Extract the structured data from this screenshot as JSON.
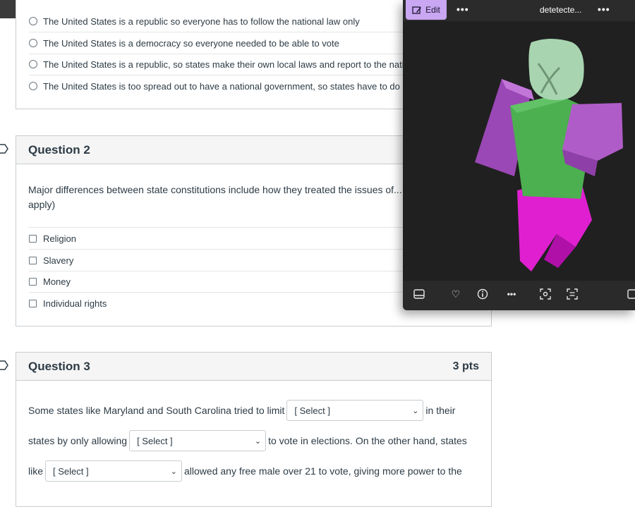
{
  "question1": {
    "answers": [
      "The United States is a republic so everyone has to follow the national law only",
      "The United States is a democracy so everyone needed to be able to vote",
      "The United States is a republic, so states make their own local laws and report to the national g",
      "The United States is too spread out to have a national government, so states have to do it"
    ]
  },
  "question2": {
    "title": "Question 2",
    "text_line1": "Major differences between state constitutions include how they treated the issues of...",
    "text_line2": "apply)",
    "options": [
      "Religion",
      "Slavery",
      "Money",
      "Individual rights"
    ]
  },
  "question3": {
    "title": "Question 3",
    "points": "3 pts",
    "line1_before": "Some states like Maryland and South Carolina tried to limit",
    "line1_after": "in their",
    "line2_before": "states by only allowing",
    "line2_after": "to vote in elections. On the other hand, states",
    "line3_before": "like",
    "line3_after": "allowed any free male over 21 to vote, giving more power to the",
    "select_placeholder": "[ Select ]"
  },
  "viewer": {
    "edit_label": "Edit",
    "title": "detetecte...",
    "more_label": "•••"
  },
  "colors": {
    "accent_edit": "#c9a7f2",
    "figure_head": "#a8d5b0",
    "figure_body": "#4caf50",
    "figure_arms": "#b05cc8",
    "figure_legs": "#e020d0"
  }
}
